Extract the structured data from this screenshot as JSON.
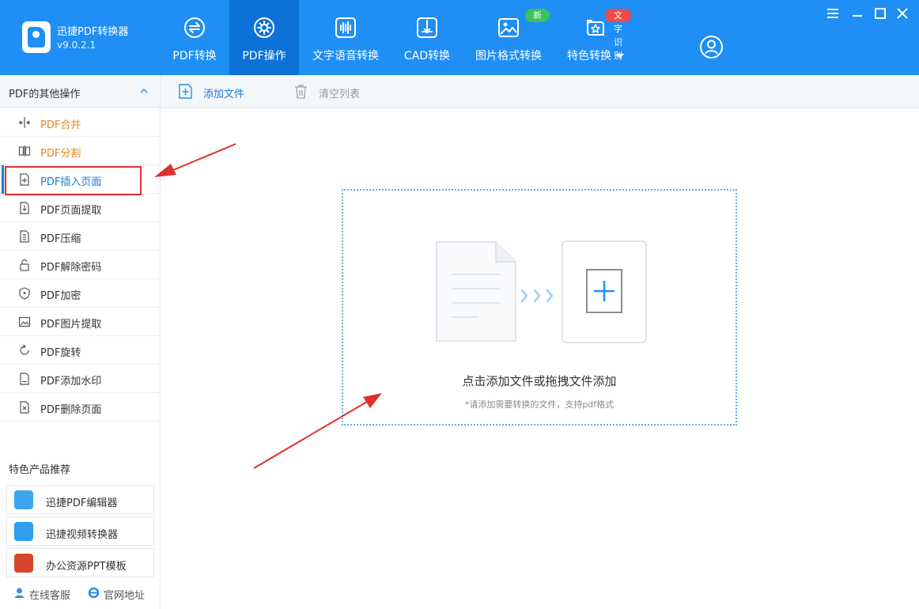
{
  "app": {
    "name": "迅捷PDF转换器",
    "version": "v9.0.2.1"
  },
  "nav": {
    "tabs": [
      {
        "label": "PDF转换"
      },
      {
        "label": "PDF操作"
      },
      {
        "label": "文字语音转换"
      },
      {
        "label": "CAD转换"
      },
      {
        "label": "图片格式转换",
        "badge": "新"
      },
      {
        "label": "特色转换",
        "badge": "文字识别"
      }
    ]
  },
  "sidebar": {
    "header": "PDF的其他操作",
    "items": [
      {
        "label": "PDF合并"
      },
      {
        "label": "PDF分割"
      },
      {
        "label": "PDF插入页面"
      },
      {
        "label": "PDF页面提取"
      },
      {
        "label": "PDF压缩"
      },
      {
        "label": "PDF解除密码"
      },
      {
        "label": "PDF加密"
      },
      {
        "label": "PDF图片提取"
      },
      {
        "label": "PDF旋转"
      },
      {
        "label": "PDF添加水印"
      },
      {
        "label": "PDF删除页面"
      }
    ],
    "promo_title": "特色产品推荐",
    "promos": [
      {
        "label": "迅捷PDF编辑器"
      },
      {
        "label": "迅捷视频转换器"
      },
      {
        "label": "办公资源PPT模板"
      }
    ],
    "footer": {
      "service": "在线客服",
      "website": "官网地址"
    }
  },
  "toolbar": {
    "add_file": "添加文件",
    "clear_list": "清空列表"
  },
  "drop_area": {
    "main_text": "点击添加文件或拖拽文件添加",
    "sub_text": "*请添加需要转换的文件，支持pdf格式"
  },
  "colors": {
    "topbar": "#1f8ef5",
    "topbar_active_tab": "#0c72d8",
    "accent_blue": "#1a7bd9",
    "accent_orange": "#e08a21",
    "highlight_red": "#e0302d",
    "badge_new": "#3cc15b",
    "badge_ocr": "#f04a4a"
  }
}
